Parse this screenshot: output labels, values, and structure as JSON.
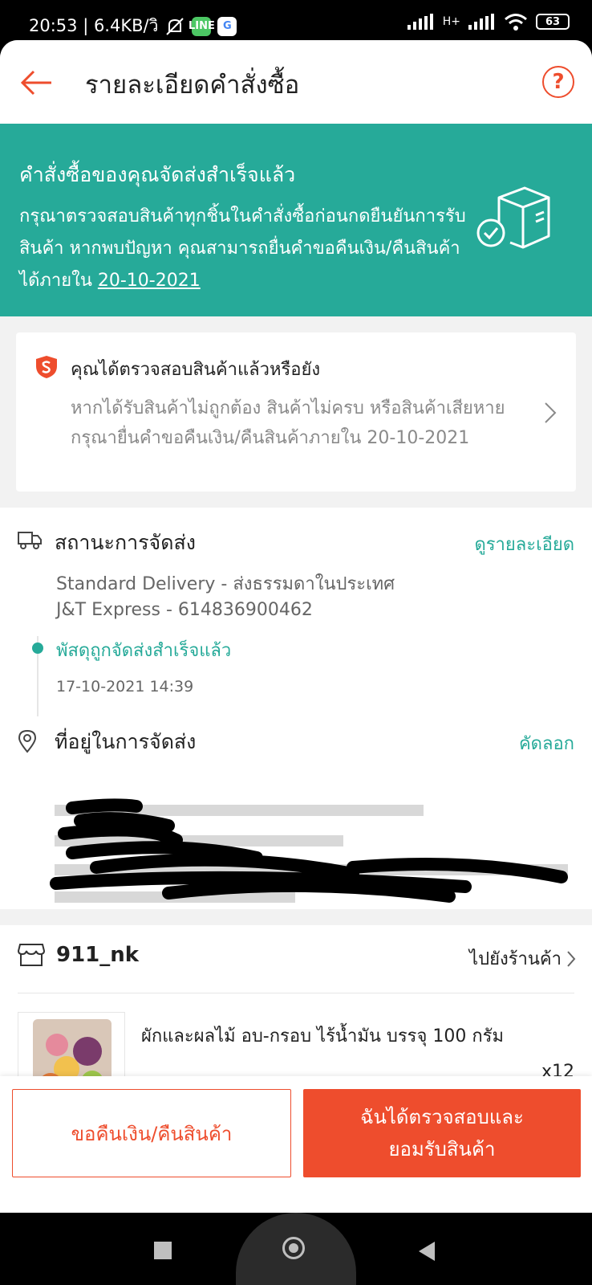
{
  "status_bar": {
    "time_speed": "20:53 | 6.4KB/วิ",
    "line_icon": "LINE",
    "google_icon": "G",
    "network_label": "H+",
    "battery": "63"
  },
  "header": {
    "title": "รายละเอียดคำสั่งซื้อ",
    "help_label": "?"
  },
  "banner": {
    "title": "คำสั่งซื้อของคุณจัดส่งสำเร็จแล้ว",
    "text": "กรุณาตรวจสอบสินค้าทุกชิ้นในคำสั่งซื้อก่อนกดยืนยันการรับสินค้า หากพบปัญหา คุณสามารถยื่นคำขอคืนเงิน/คืนสินค้าได้ภายใน ",
    "deadline": "20-10-2021"
  },
  "inspect_card": {
    "title": "คุณได้ตรวจสอบสินค้าแล้วหรือยัง",
    "text": "หากได้รับสินค้าไม่ถูกต้อง สินค้าไม่ครบ หรือสินค้าเสียหาย กรุณายื่นคำขอคืนเงิน/คืนสินค้าภายใน 20-10-2021"
  },
  "shipping": {
    "title": "สถานะการจัดส่ง",
    "detail_link": "ดูรายละเอียด",
    "method": "Standard Delivery - ส่งธรรมดาในประเทศ",
    "carrier": "J&T Express - 614836900462",
    "status": "พัสดุถูกจัดส่งสำเร็จแล้ว",
    "status_time": "17-10-2021 14:39"
  },
  "address": {
    "title": "ที่อยู่ในการจัดส่ง",
    "copy_link": "คัดลอก"
  },
  "shop": {
    "name": "911_nk",
    "go_link": "ไปยังร้านค้า",
    "product_name": "ผักและผลไม้ อบ-กรอบ ไร้น้ำมัน  บรรจุ 100  กรัม",
    "quantity": "x12"
  },
  "actions": {
    "refund": "ขอคืนเงิน/คืนสินค้า",
    "confirm_line1": "ฉันได้ตรวจสอบและ",
    "confirm_line2": "ยอมรับสินค้า"
  },
  "colors": {
    "accent": "#ee4d2d",
    "teal": "#26aa99"
  }
}
